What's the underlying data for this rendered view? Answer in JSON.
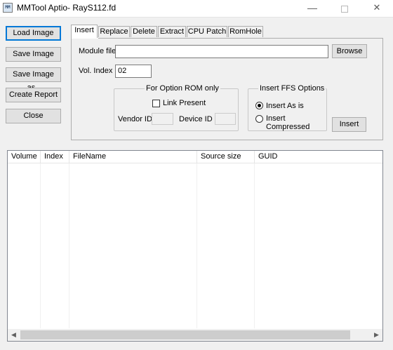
{
  "window": {
    "title": "MMTool Aptio- RayS112.fd",
    "icon_text": "MM",
    "minimize": "—",
    "close": "✕"
  },
  "side_buttons": {
    "load_image": "Load Image",
    "save_image": "Save Image",
    "save_image_as": "Save Image as..",
    "create_report": "Create Report",
    "close": "Close"
  },
  "tabs": [
    {
      "label": "Insert",
      "active": true
    },
    {
      "label": "Replace"
    },
    {
      "label": "Delete"
    },
    {
      "label": "Extract"
    },
    {
      "label": "CPU Patch"
    },
    {
      "label": "RomHole"
    }
  ],
  "insert_tab": {
    "module_file_label": "Module file",
    "module_file_value": "",
    "browse_label": "Browse",
    "vol_index_label": "Vol. Index",
    "vol_index_value": "02",
    "option_rom_group": "For Option ROM only",
    "link_present_label": "Link Present",
    "vendor_id_label": "Vendor ID",
    "device_id_label": "Device ID",
    "ffs_group": "Insert FFS Options",
    "insert_as_is_label": "Insert As is",
    "insert_compressed_label": "Insert Compressed",
    "insert_button": "Insert"
  },
  "list": {
    "columns": [
      "Volume",
      "Index",
      "FileName",
      "Source size",
      "GUID"
    ],
    "rows": []
  }
}
